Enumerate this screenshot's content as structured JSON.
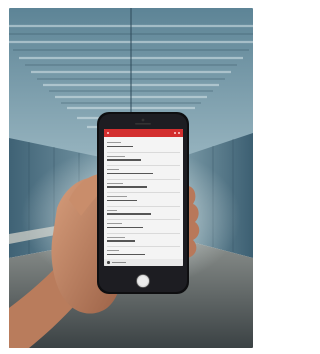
{
  "scene": {
    "subject": "hand-holding-smartphone",
    "setting": "tunnel-corridor",
    "colors": {
      "ceiling": "#7ea3b4",
      "wall": "#5a7f93",
      "floor": "#4a5254",
      "skin": "#c58a68",
      "phone_body": "#0e0e10",
      "app_accent": "#d32f2f"
    }
  },
  "phone_app": {
    "rows": 9
  }
}
